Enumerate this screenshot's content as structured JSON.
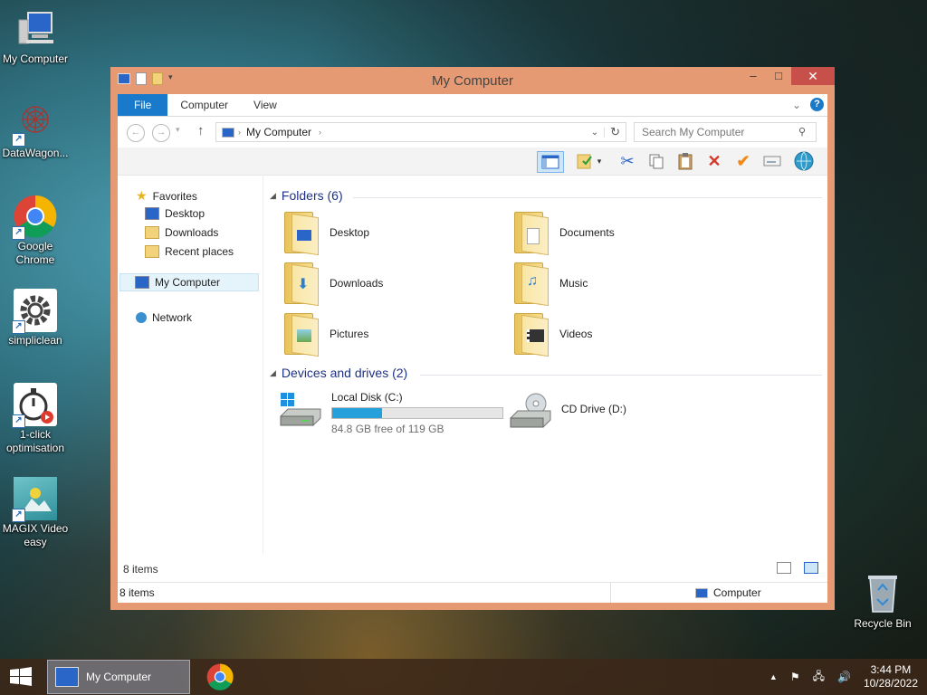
{
  "desktop": {
    "icons": [
      {
        "label": "My Computer"
      },
      {
        "label": "DataWagon..."
      },
      {
        "label": "Google Chrome"
      },
      {
        "label": "simpliclean"
      },
      {
        "label": "1-click optimisation"
      },
      {
        "label": "MAGIX Video easy"
      },
      {
        "label": "Recycle Bin"
      }
    ]
  },
  "window": {
    "title": "My Computer",
    "controls": {
      "minimize": "–",
      "maximize": "□",
      "close": "✕"
    },
    "ribbon_tabs": [
      "File",
      "Computer",
      "View"
    ],
    "address": {
      "path": "My Computer"
    },
    "search": {
      "placeholder": "Search My Computer"
    },
    "nav": {
      "favorites": "Favorites",
      "favorites_items": [
        "Desktop",
        "Downloads",
        "Recent places"
      ],
      "my_computer": "My Computer",
      "network": "Network"
    },
    "groups": {
      "folders": "Folders (6)",
      "devices": "Devices and drives (2)"
    },
    "folders": [
      "Desktop",
      "Documents",
      "Downloads",
      "Music",
      "Pictures",
      "Videos"
    ],
    "drives": [
      {
        "name": "Local Disk (C:)",
        "free_text": "84.8 GB free of 119 GB",
        "used_fraction": 0.29
      },
      {
        "name": "CD Drive (D:)"
      }
    ],
    "item_count": "8 items",
    "status": {
      "left": "8 items",
      "right": "Computer"
    }
  },
  "taskbar": {
    "active_window": "My Computer",
    "clock_time": "3:44 PM",
    "clock_date": "10/28/2022"
  },
  "colors": {
    "accent": "#1979ca",
    "titlebar": "#e59a73",
    "close": "#c7504b",
    "group_header": "#1e3287",
    "drive_fill": "#26a0da"
  }
}
